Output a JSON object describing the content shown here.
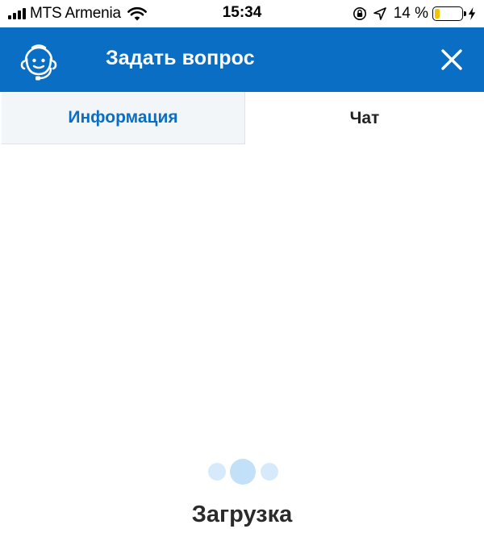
{
  "status_bar": {
    "carrier": "MTS Armenia",
    "time": "15:34",
    "battery_percent": "14 %",
    "battery_level": 0.14
  },
  "header": {
    "title": "Задать вопрос",
    "icon": "headset-support-icon",
    "close_icon": "close-icon"
  },
  "tabs": [
    {
      "label": "Информация",
      "active": true
    },
    {
      "label": "Чат",
      "active": false
    }
  ],
  "content": {
    "loading_text": "Загрузка"
  },
  "colors": {
    "brand_blue": "#0a6fc4",
    "active_tab_bg": "#f3f6f9",
    "loader_dot": "#c3e0f9",
    "battery_fill": "#f5c400"
  }
}
